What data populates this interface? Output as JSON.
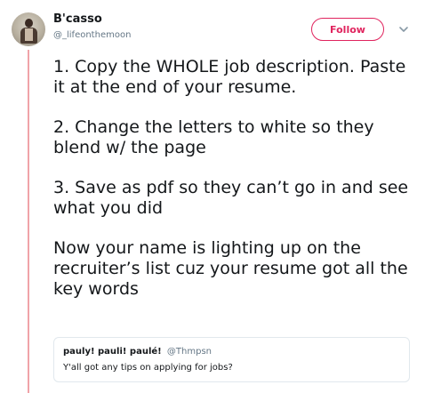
{
  "author": {
    "display_name": "B'casso",
    "handle": "@_lifeonthemoon"
  },
  "actions": {
    "follow_label": "Follow",
    "more_icon": "chevron-down-icon"
  },
  "tweet": {
    "paragraphs": [
      "1. Copy the WHOLE job description. Paste it at the end of your resume.",
      "2. Change the letters to white so they blend w/ the page",
      "3. Save as pdf so they can’t go in and see what you did",
      "Now your name is lighting up on the recruiter’s list cuz your resume got all the key words"
    ]
  },
  "quoted_tweet": {
    "display_name": "pauly! pauli! paulé!",
    "handle": "@Thmpsn",
    "text": "Y'all got any tips on applying for jobs?"
  },
  "colors": {
    "accent": "#e0245e",
    "thread_line": "#f0a3a8",
    "secondary_text": "#657786",
    "border": "#e1e8ed"
  }
}
